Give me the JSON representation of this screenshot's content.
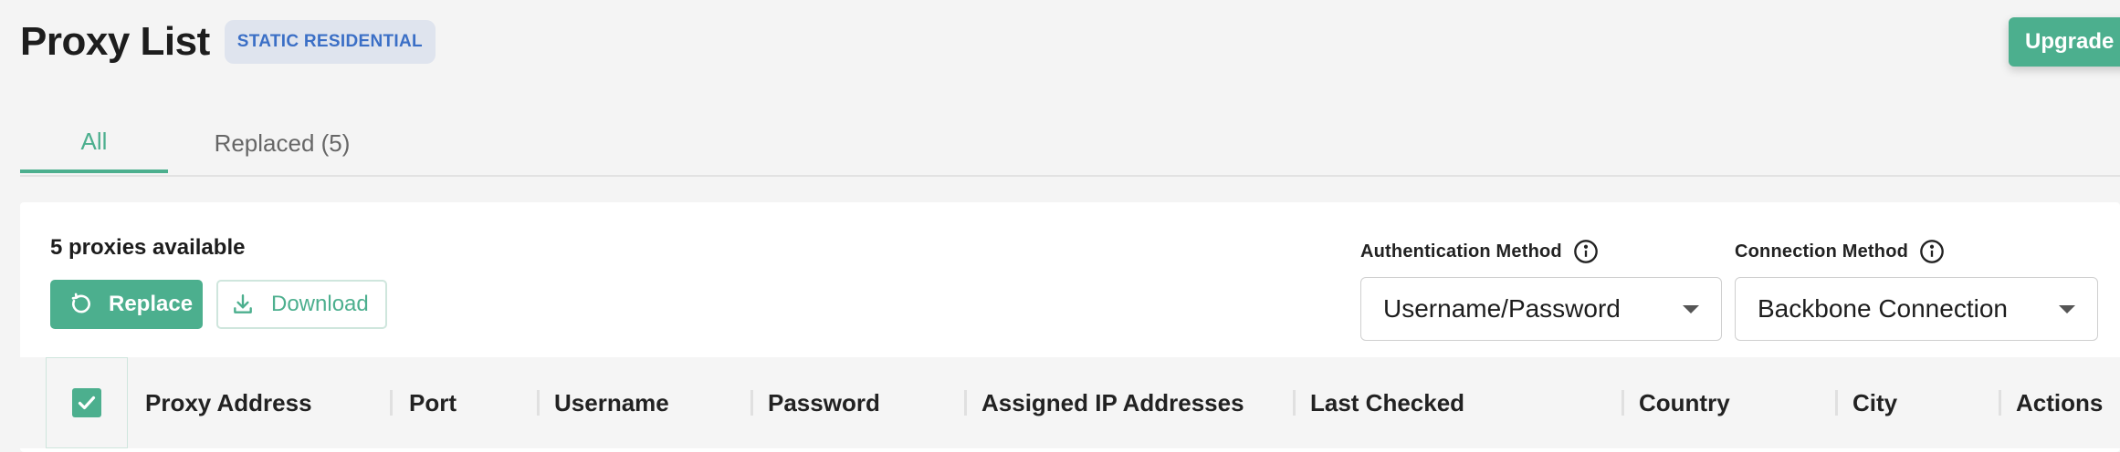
{
  "header": {
    "title": "Proxy List",
    "badge": "STATIC RESIDENTIAL",
    "upgrade_label": "Upgrade"
  },
  "tabs": [
    {
      "label": "All",
      "active": true
    },
    {
      "label": "Replaced (5)",
      "active": false
    }
  ],
  "panel": {
    "available_text": "5 proxies available",
    "replace_label": "Replace",
    "download_label": "Download",
    "auth": {
      "label": "Authentication Method",
      "value": "Username/Password"
    },
    "connection": {
      "label": "Connection Method",
      "value": "Backbone Connection"
    }
  },
  "table": {
    "select_all_checked": true,
    "columns": [
      "Proxy Address",
      "Port",
      "Username",
      "Password",
      "Assigned IP Addresses",
      "Last Checked",
      "Country",
      "City",
      "Actions"
    ]
  },
  "colors": {
    "accent": "#4caf8e",
    "badge_bg": "#dfe4ee",
    "badge_text": "#3b6fc6"
  },
  "icons": {
    "replace": "refresh-icon",
    "download": "download-icon",
    "info": "info-icon",
    "dropdown": "caret-down-icon",
    "check": "check-icon"
  }
}
